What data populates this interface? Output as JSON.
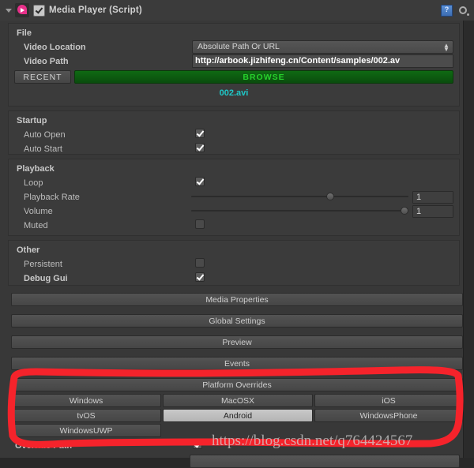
{
  "header": {
    "title": "Media Player (Script)",
    "enabled_checkbox": true,
    "foldout_open": true,
    "script_icon": "media-player-script-icon",
    "help_icon": "help-book-icon",
    "settings_icon": "gear-icon"
  },
  "file_section": {
    "title": "File",
    "video_location_label": "Video Location",
    "video_location_value": "Absolute Path Or URL",
    "video_path_label": "Video Path",
    "video_path_value": "http://arbook.jizhifeng.cn/Content/samples/002.av",
    "recent_button": "RECENT",
    "browse_button": "BROWSE",
    "current_file": "002.avi",
    "browse_color": "#0d5a11",
    "file_name_color": "#1fc8c8"
  },
  "startup_section": {
    "title": "Startup",
    "rows": [
      {
        "label": "Auto Open",
        "checked": true
      },
      {
        "label": "Auto Start",
        "checked": true
      }
    ]
  },
  "playback_section": {
    "title": "Playback",
    "loop_label": "Loop",
    "loop_checked": true,
    "playback_rate_label": "Playback Rate",
    "playback_rate_value": "1",
    "playback_rate_fraction": 0.63,
    "volume_label": "Volume",
    "volume_value": "1",
    "volume_fraction": 1.0,
    "muted_label": "Muted",
    "muted_checked": false
  },
  "other_section": {
    "title": "Other",
    "persistent_label": "Persistent",
    "persistent_checked": false,
    "debug_gui_label": "Debug Gui",
    "debug_gui_checked": true
  },
  "section_buttons": [
    "Media Properties",
    "Global Settings",
    "Preview",
    "Events",
    "Platform Overrides"
  ],
  "platform_overrides": {
    "header": "Platform Overrides",
    "buttons": [
      {
        "label": "Windows",
        "selected": false
      },
      {
        "label": "MacOSX",
        "selected": false
      },
      {
        "label": "iOS",
        "selected": false
      },
      {
        "label": "tvOS",
        "selected": false
      },
      {
        "label": "Android",
        "selected": true
      },
      {
        "label": "WindowsPhone",
        "selected": false
      },
      {
        "label": "WindowsUWP",
        "selected": false
      }
    ]
  },
  "override_section": {
    "override_path_label": "Override Path",
    "override_path_checked": true
  },
  "annotation": {
    "highlight_color": "#f5232b",
    "watermark": "https://blog.csdn.net/q764424567"
  }
}
